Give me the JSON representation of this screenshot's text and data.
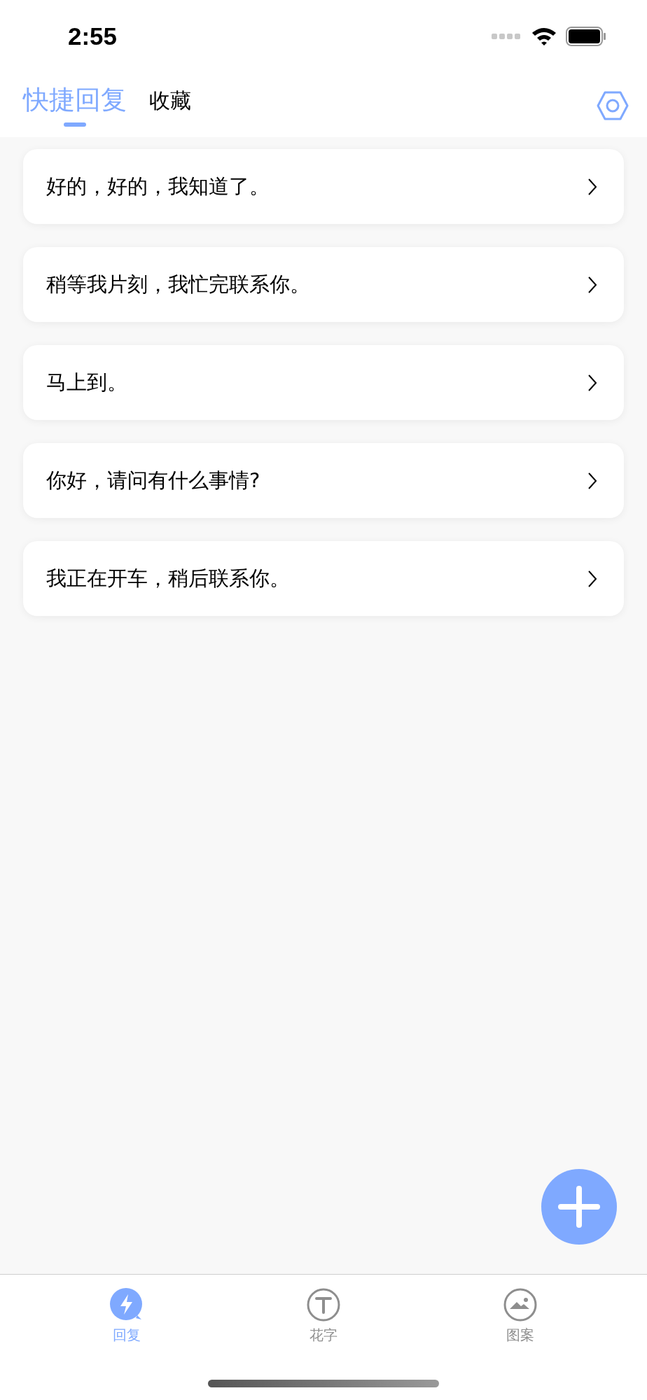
{
  "status_bar": {
    "time": "2:55"
  },
  "header_tabs": [
    {
      "label": "快捷回复",
      "selected": true
    },
    {
      "label": "收藏",
      "selected": false
    }
  ],
  "replies": [
    {
      "text": "好的，好的，我知道了。"
    },
    {
      "text": "稍等我片刻，我忙完联系你。"
    },
    {
      "text": "马上到。"
    },
    {
      "text": "你好，请问有什么事情?"
    },
    {
      "text": "我正在开车，稍后联系你。"
    }
  ],
  "tab_bar": [
    {
      "label": "回复",
      "kind": "reply",
      "selected": true
    },
    {
      "label": "花字",
      "kind": "text",
      "selected": false
    },
    {
      "label": "图案",
      "kind": "pattern",
      "selected": false
    }
  ]
}
